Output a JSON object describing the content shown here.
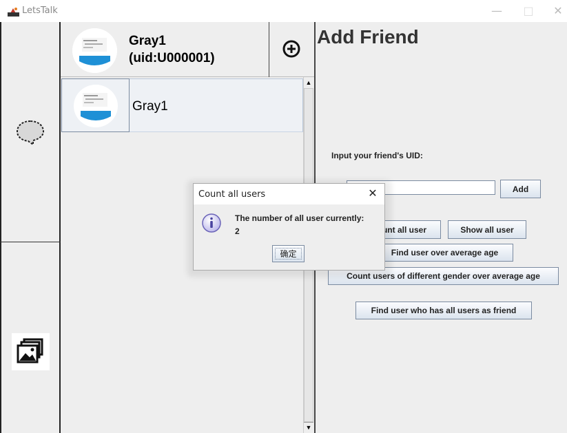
{
  "window": {
    "title": "LetsTalk",
    "minimize": "—",
    "maximize": "□",
    "close": "✕"
  },
  "nav": {
    "chat_icon": "speech-bubble-icon",
    "image_icon": "images-icon"
  },
  "profile": {
    "name": "Gray1",
    "uid": "(uid:U000001)"
  },
  "friends": [
    {
      "name": "Gray1"
    }
  ],
  "scroll": {
    "up": "▲",
    "down": "▼"
  },
  "add_friend": {
    "title": "Add Friend",
    "uid_label": "Input your friend's UID:",
    "uid_value": "",
    "add_label": "Add",
    "count_all_label": "Count all user",
    "show_all_label": "Show all user",
    "avg_age_label": "Find user over average age",
    "gender_label": "Count users of different gender over average age",
    "all_friend_label": "Find user who has all users as friend"
  },
  "dialog": {
    "title": "Count all users",
    "close": "✕",
    "message": "The number of all user currently:",
    "count": "2",
    "ok_label": "确定"
  },
  "colors": {
    "panel_bg": "#eeeeee",
    "button_border": "#7a8aa0",
    "avatar_accent": "#1e90d6"
  }
}
